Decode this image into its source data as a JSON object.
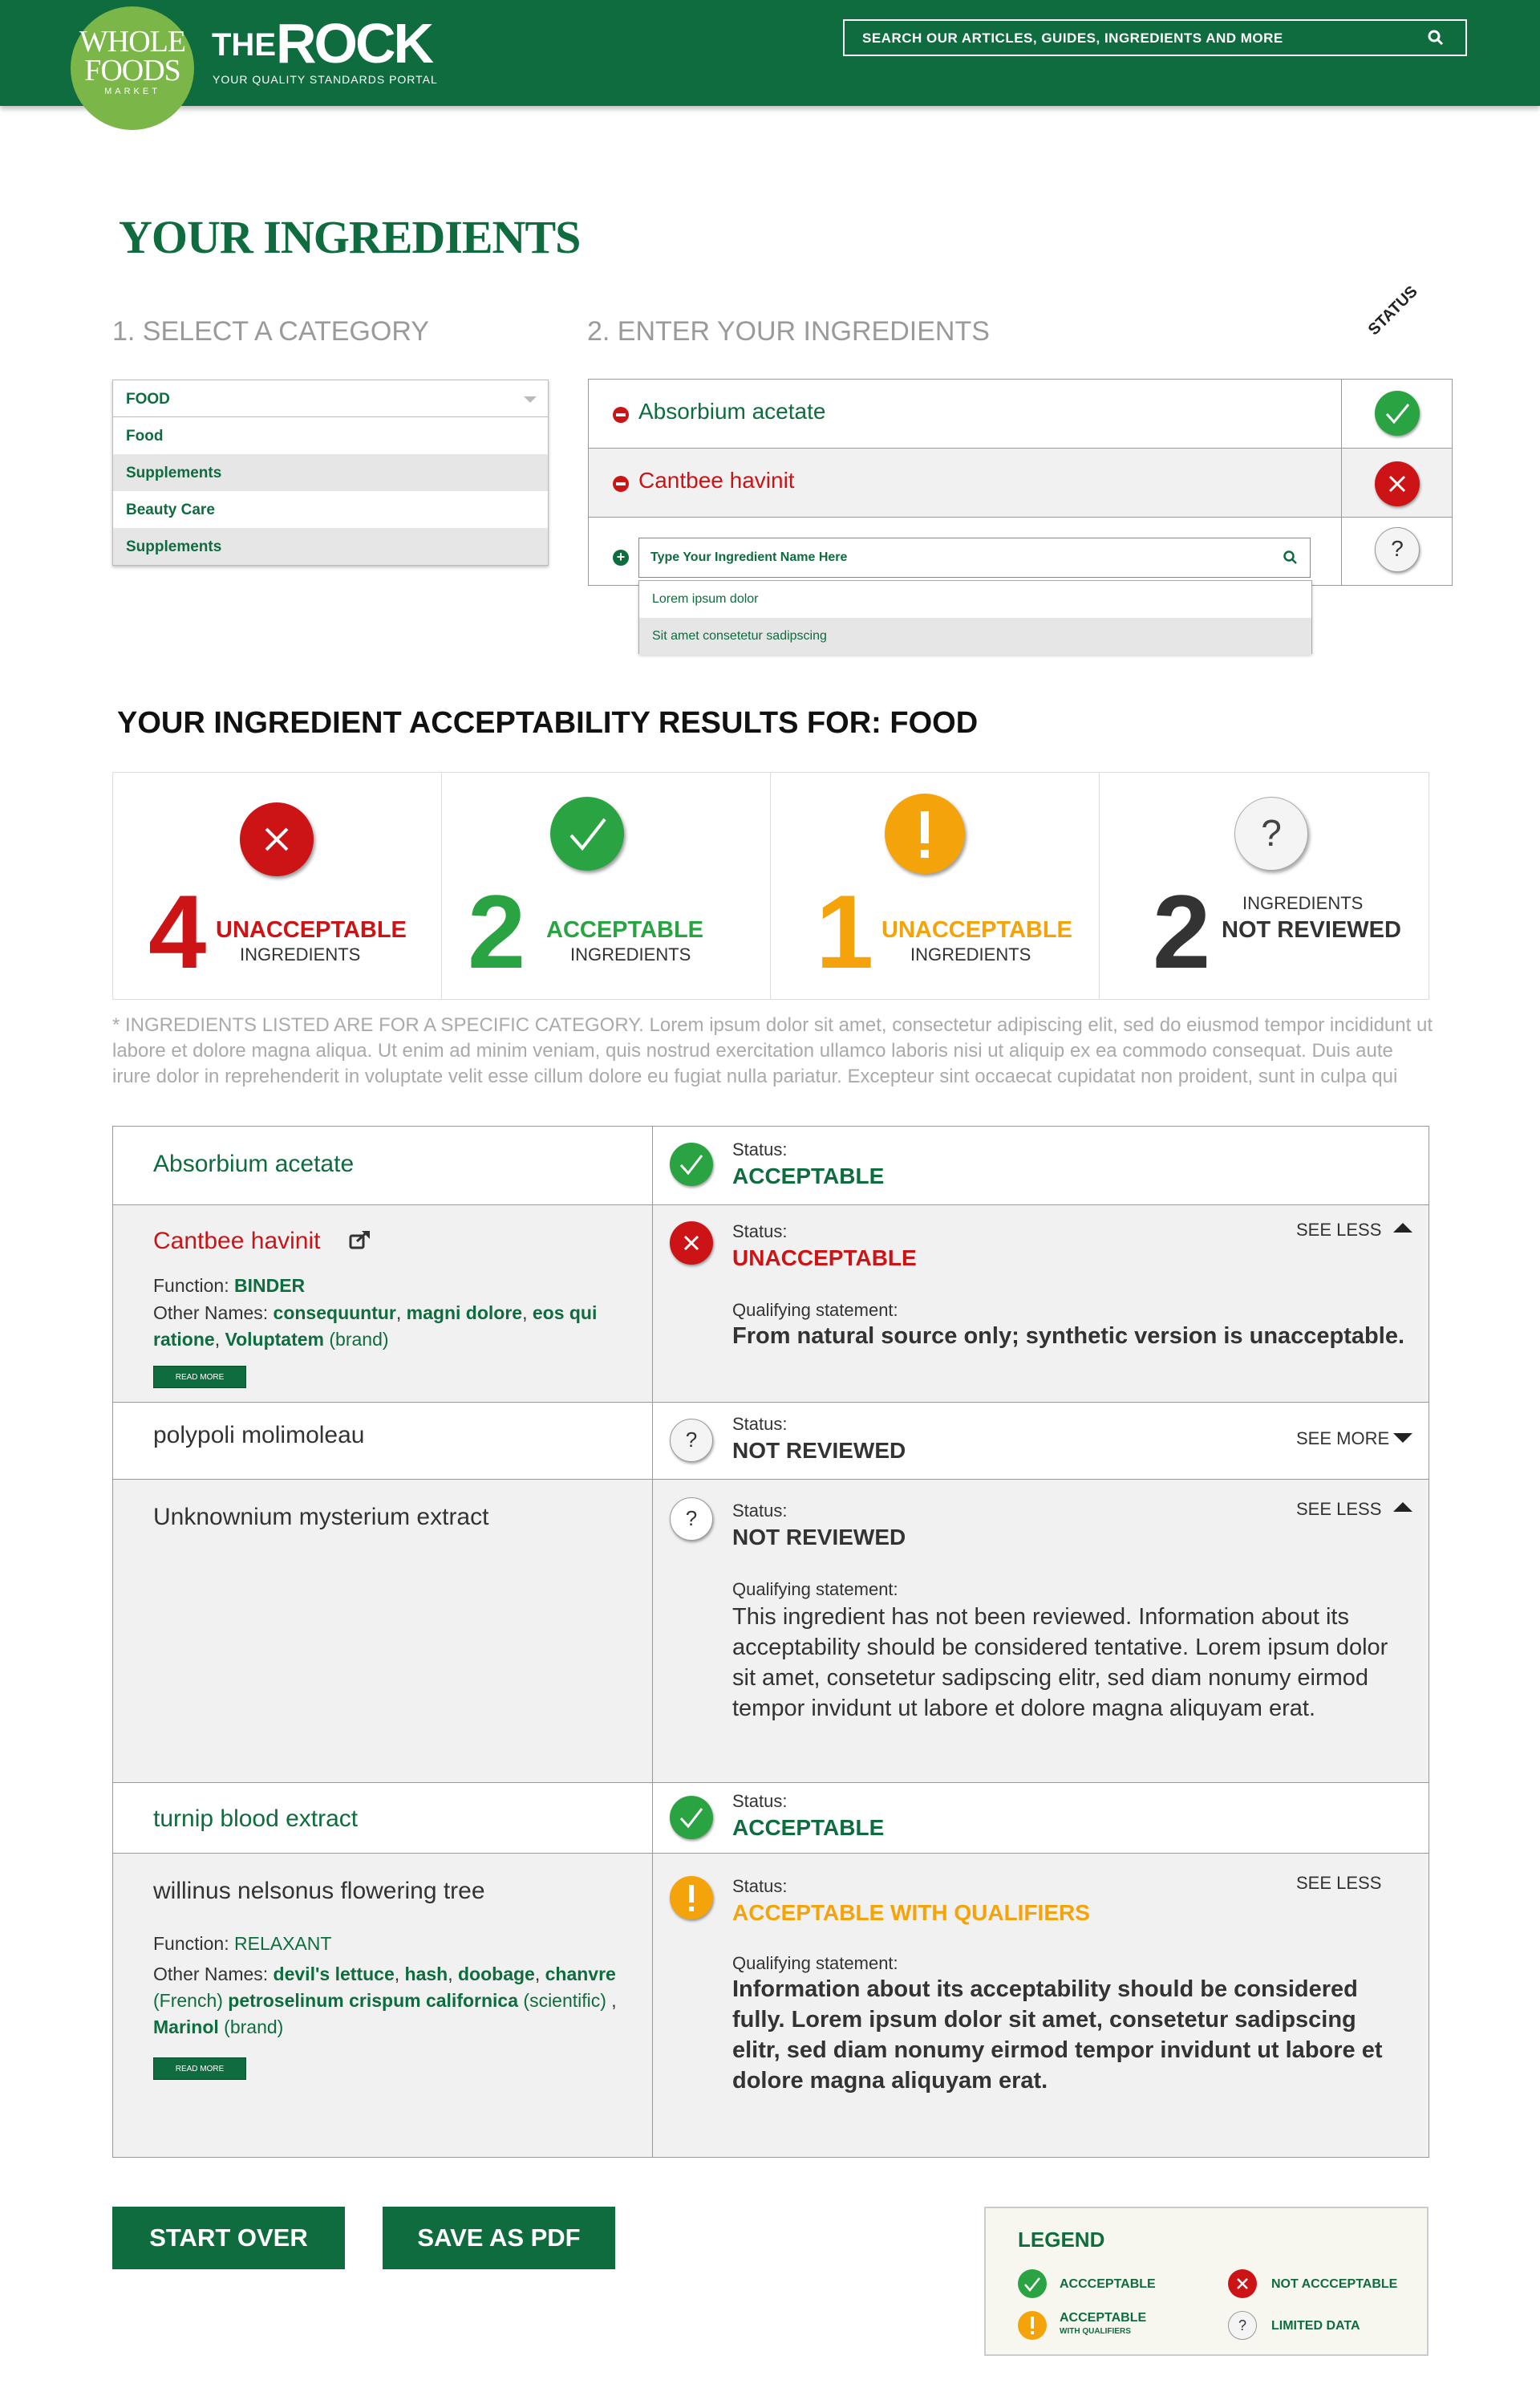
{
  "header": {
    "logo_line1": "WHOLE",
    "logo_line2": "FOODS",
    "logo_line3": "MARKET",
    "brand_the": "THE",
    "brand_rock": "ROCK",
    "tagline": "YOUR QUALITY STANDARDS PORTAL",
    "search_placeholder": "SEARCH OUR ARTICLES, GUIDES, INGREDIENTS AND MORE"
  },
  "page_title": "YOUR INGREDIENTS",
  "step1_label": "1. SELECT A CATEGORY",
  "step2_label": "2. ENTER YOUR INGREDIENTS",
  "status_header": "STATUS",
  "category": {
    "selected": "FOOD",
    "options": [
      "Food",
      "Supplements",
      "Beauty Care",
      "Supplements"
    ]
  },
  "ingredients": [
    {
      "name": "Absorbium acetate",
      "status": "acceptable"
    },
    {
      "name": "Cantbee havinit",
      "status": "unacceptable"
    }
  ],
  "ingredient_input": {
    "placeholder": "Type Your Ingredient Name Here",
    "suggestions": [
      "Lorem ipsum dolor",
      "Sit amet consetetur sadipscing"
    ]
  },
  "results_title": "YOUR INGREDIENT ACCEPTABILITY RESULTS FOR: FOOD",
  "summary": [
    {
      "count": "4",
      "label": "UNACCEPTABLE",
      "sub": "INGREDIENTS",
      "color": "#cc1417"
    },
    {
      "count": "2",
      "label": "ACCEPTABLE",
      "sub": "INGREDIENTS",
      "color": "#2aa343"
    },
    {
      "count": "1",
      "label": "UNACCEPTABLE",
      "sub": "INGREDIENTS",
      "color": "#f5a30a"
    },
    {
      "count": "2",
      "label": "NOT REVIEWED",
      "sub": "INGREDIENTS",
      "color": "#333333"
    }
  ],
  "disclaimer": "* INGREDIENTS LISTED ARE FOR A SPECIFIC CATEGORY. Lorem ipsum dolor sit amet, consectetur adipiscing elit, sed do eiusmod tempor incididunt ut labore et dolore magna aliqua. Ut enim ad minim veniam, quis nostrud exercitation ullamco laboris nisi ut aliquip ex ea commodo consequat. Duis aute irure dolor in reprehenderit in voluptate velit esse cillum dolore eu fugiat nulla pariatur. Excepteur sint occaecat cupidatat non proident, sunt in culpa qui",
  "details": {
    "status_label": "Status:",
    "qualifying_label": "Qualifying statement:",
    "see_less": "SEE LESS",
    "see_more": "SEE MORE",
    "read_more": "READ MORE",
    "function_label": "Function:",
    "other_names_label": "Other Names:",
    "rows": [
      {
        "name": "Absorbium acetate",
        "status": "ACCEPTABLE"
      },
      {
        "name": "Cantbee havinit",
        "status": "UNACCEPTABLE",
        "function": "BINDER",
        "other_1": "consequuntur",
        "other_2": "magni dolore",
        "other_3": "eos qui ratione",
        "other_4": "Voluptatem",
        "other_4_note": "(brand)",
        "qualifying": "From natural source only; synthetic version is unacceptable."
      },
      {
        "name": "polypoli molimoleau",
        "status": "NOT REVIEWED"
      },
      {
        "name": "Unknownium mysterium extract",
        "status": "NOT REVIEWED",
        "qualifying": "This ingredient has not been reviewed. Information about its acceptability should be considered tentative. Lorem ipsum dolor sit amet, consetetur sadipscing elitr, sed diam nonumy eirmod tempor invidunt ut labore et dolore magna aliquyam erat."
      },
      {
        "name": "turnip blood extract",
        "status": "ACCEPTABLE"
      },
      {
        "name": "willinus nelsonus flowering tree",
        "status": "ACCEPTABLE WITH QUALIFIERS",
        "function": "RELAXANT",
        "other_1": "devil's lettuce",
        "other_2": "hash",
        "other_3": "doobage",
        "other_4": "chanvre",
        "other_4_note": "(French)",
        "other_5": "petroselinum crispum californica",
        "other_5_note": "(scientific)",
        "other_6": "Marinol",
        "other_6_note": "(brand)",
        "qualifying": "Information about its acceptability should be considered fully. Lorem ipsum dolor sit amet, consetetur sadipscing elitr, sed diam nonumy eirmod tempor invidunt ut labore et dolore magna aliquyam erat."
      }
    ]
  },
  "buttons": {
    "start_over": "START OVER",
    "save_pdf": "SAVE AS PDF"
  },
  "legend": {
    "title": "LEGEND",
    "acceptable": "ACCCEPTABLE",
    "not_acceptable": "NOT ACCCEPTABLE",
    "acceptable_q": "ACCEPTABLE",
    "acceptable_q_sub": "WITH QUALIFIERS",
    "limited": "LIMITED DATA"
  },
  "colors": {
    "brand_green": "#0e6c3f",
    "logo_green": "#7ab648",
    "acceptable": "#2aa343",
    "unacceptable": "#cc1417",
    "qualifiers": "#f5a30a"
  }
}
